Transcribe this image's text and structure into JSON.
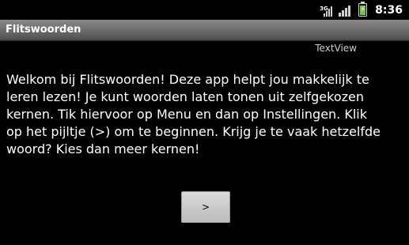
{
  "status_bar": {
    "network_type": "3G",
    "time": "8:36",
    "battery_level": 0.8,
    "battery_color": "#6cc83b"
  },
  "app": {
    "title": "Flitswoorden"
  },
  "main": {
    "textview_label": "TextView",
    "welcome_text": "Welkom bij Flitswoorden! Deze app helpt jou makkelijk te\nleren lezen! Je kunt woorden laten tonen uit zelfgekozen\nkernen. Tik hiervoor op Menu en dan op Instellingen. Klik\nop het pijltje (>) om te beginnen. Krijg je te vaak hetzelfde\nwoord? Kies dan meer kernen!",
    "next_button_label": ">"
  }
}
